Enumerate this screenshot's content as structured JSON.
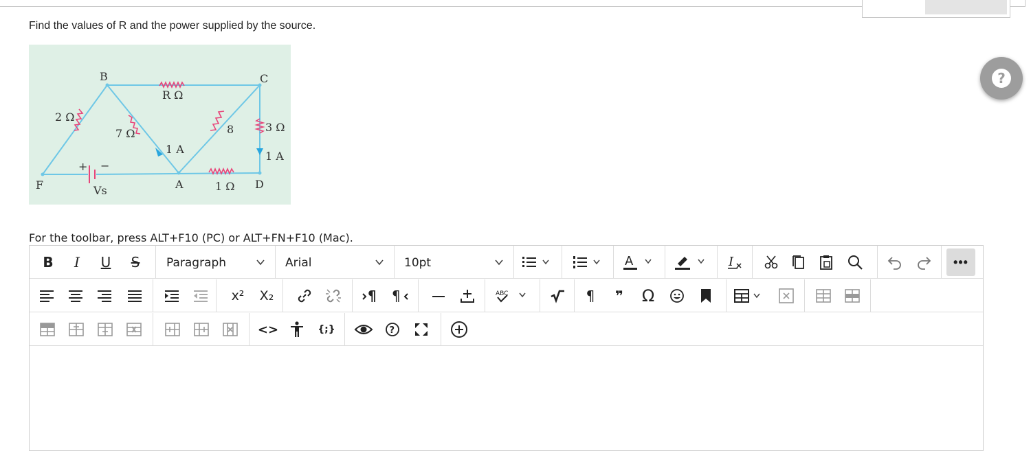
{
  "question": {
    "text": "Find the values of R and the power supplied by the source."
  },
  "circuit": {
    "labels": {
      "B": "B",
      "C": "C",
      "F": "F",
      "A": "A",
      "D": "D",
      "r_ohm": "R Ω",
      "two_ohm": "2 Ω",
      "seven_ohm": "7 Ω",
      "eight": "8",
      "three_ohm": "3 Ω",
      "one_amp_mid": "1 A",
      "one_amp_right": "1 A",
      "one_ohm": "1 Ω",
      "vs": "Vs",
      "plus": "+",
      "minus": "−"
    },
    "colors": {
      "background": "#dff0e6",
      "wire": "#6ec7e6",
      "resistor": "#e8457a",
      "arrow": "#29a6de"
    }
  },
  "help": {
    "icon": "question-icon",
    "symbol": "?"
  },
  "editor": {
    "hint": "For the toolbar, press ALT+F10 (PC) or ALT+FN+F10 (Mac).",
    "block_format": "Paragraph",
    "font_family": "Arial",
    "font_size": "10pt",
    "more_label": "•••",
    "toolbar": {
      "bold": "B",
      "italic": "I",
      "underline": "U",
      "strike": "S",
      "superscript": "x²",
      "subscript": "X₂",
      "code": "<>",
      "source": "{;}",
      "paragraph_mark": "¶",
      "quote": "❞",
      "omega": "Ω",
      "spell": "ABC"
    }
  }
}
